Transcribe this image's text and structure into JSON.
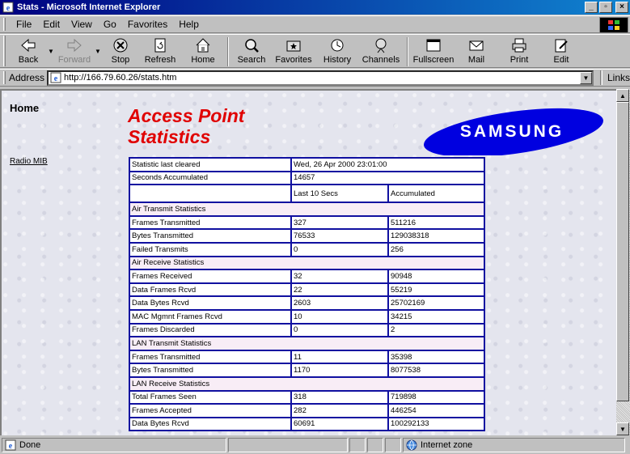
{
  "window": {
    "title": "Stats - Microsoft Internet Explorer",
    "buttons": {
      "minimize": "_",
      "maximize": "▫",
      "close": "×"
    }
  },
  "menu": [
    {
      "label": "File"
    },
    {
      "label": "Edit"
    },
    {
      "label": "View"
    },
    {
      "label": "Go"
    },
    {
      "label": "Favorites"
    },
    {
      "label": "Help"
    }
  ],
  "toolbar": {
    "back": "Back",
    "forward": "Forward",
    "stop": "Stop",
    "refresh": "Refresh",
    "home": "Home",
    "search": "Search",
    "favorites": "Favorites",
    "history": "History",
    "channels": "Channels",
    "fullscreen": "Fullscreen",
    "mail": "Mail",
    "print": "Print",
    "edit": "Edit"
  },
  "address": {
    "label": "Address",
    "url": "http://166.79.60.26/stats.htm",
    "links": "Links"
  },
  "page": {
    "nav_home": "Home",
    "nav_radio_mib": "Radio MIB",
    "title_line1": "Access Point",
    "title_line2": "Statistics",
    "brand": "SAMSUNG",
    "colors": {
      "title": "#e00000",
      "table_border": "#1010a0",
      "logo": "#0000e0"
    }
  },
  "stats": {
    "last_cleared_label": "Statistic last cleared",
    "last_cleared_value": "Wed, 26 Apr 2000 23:01:00",
    "seconds_label": "Seconds Accumulated",
    "seconds_value": "14657",
    "col_last": "Last 10 Secs",
    "col_accum": "Accumulated",
    "sections": [
      {
        "title": "Air Transmit Statistics",
        "rows": [
          {
            "label": "Frames Transmitted",
            "last": "327",
            "accum": "511216"
          },
          {
            "label": "Bytes Transmitted",
            "last": "76533",
            "accum": "129038318"
          },
          {
            "label": "Failed Transmits",
            "last": "0",
            "accum": "256"
          }
        ]
      },
      {
        "title": "Air Receive Statistics",
        "rows": [
          {
            "label": "Frames Received",
            "last": "32",
            "accum": "90948"
          },
          {
            "label": "Data Frames Rcvd",
            "last": "22",
            "accum": "55219"
          },
          {
            "label": "Data Bytes Rcvd",
            "last": "2603",
            "accum": "25702169"
          },
          {
            "label": "MAC Mgmnt Frames Rcvd",
            "last": "10",
            "accum": "34215"
          },
          {
            "label": "Frames Discarded",
            "last": "0",
            "accum": "2"
          }
        ]
      },
      {
        "title": "LAN Transmit Statistics",
        "rows": [
          {
            "label": "Frames Transmitted",
            "last": "11",
            "accum": "35398"
          },
          {
            "label": "Bytes Transmitted",
            "last": "1170",
            "accum": "8077538"
          }
        ]
      },
      {
        "title": "LAN Receive Statistics",
        "rows": [
          {
            "label": "Total Frames Seen",
            "last": "318",
            "accum": "719898"
          },
          {
            "label": "Frames Accepted",
            "last": "282",
            "accum": "446254"
          },
          {
            "label": "Data Bytes Rcvd",
            "last": "60691",
            "accum": "100292133"
          }
        ]
      }
    ]
  },
  "status": {
    "text": "Done",
    "zone": "Internet zone"
  }
}
